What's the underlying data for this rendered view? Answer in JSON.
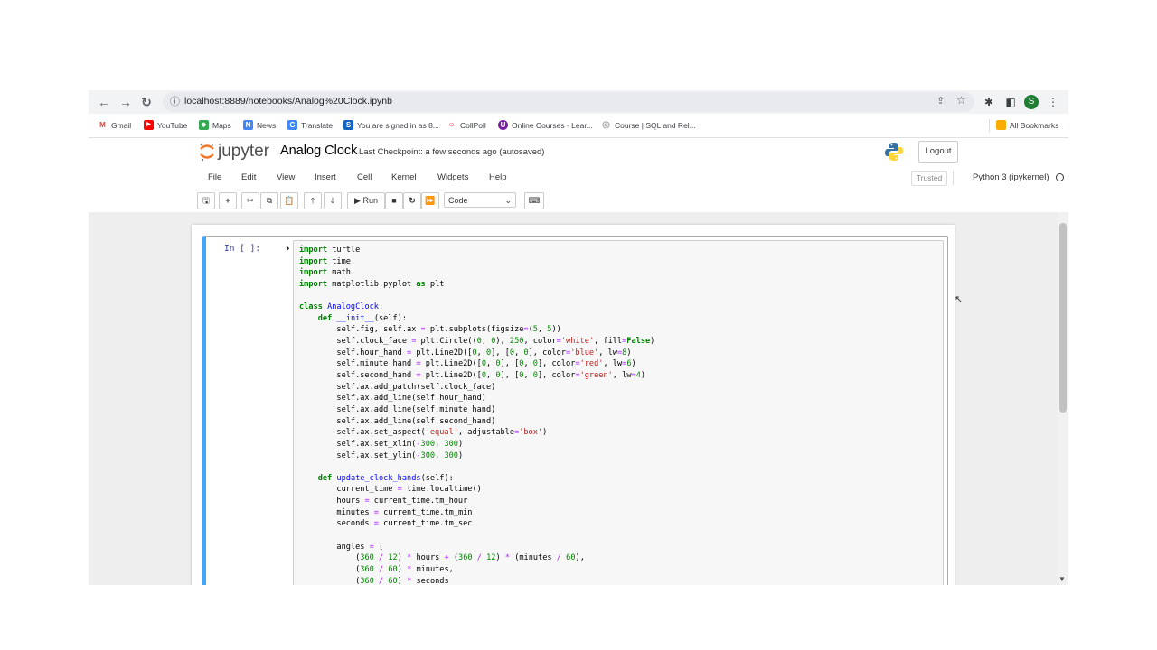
{
  "browser": {
    "url": "localhost:8889/notebooks/Analog%20Clock.ipynb",
    "avatar_letter": "S",
    "bookmarks": [
      {
        "label": "Gmail",
        "icon": "gmail-icon",
        "color": "#ea4335",
        "glyph": "M"
      },
      {
        "label": "YouTube",
        "icon": "youtube-icon",
        "color": "#ff0000",
        "glyph": "▶"
      },
      {
        "label": "Maps",
        "icon": "maps-icon",
        "color": "#34a853",
        "glyph": "◆"
      },
      {
        "label": "News",
        "icon": "news-icon",
        "color": "#4285f4",
        "glyph": "N"
      },
      {
        "label": "Translate",
        "icon": "translate-icon",
        "color": "#4285f4",
        "glyph": "G"
      },
      {
        "label": "You are signed in as 8...",
        "icon": "s-icon",
        "color": "#1565c0",
        "glyph": "S"
      },
      {
        "label": "CollPoll",
        "icon": "collpoll-icon",
        "color": "#e53935",
        "glyph": "○"
      },
      {
        "label": "Online Courses - Lear...",
        "icon": "udemy-icon",
        "color": "#7b1fa2",
        "glyph": "U"
      },
      {
        "label": "Course | SQL and Rel...",
        "icon": "globe-icon",
        "color": "#9e9e9e",
        "glyph": "◎"
      }
    ],
    "all_bookmarks": "All Bookmarks"
  },
  "jupyter": {
    "logo_text": "jupyter",
    "notebook_title": "Analog Clock",
    "checkpoint": "Last Checkpoint: a few seconds ago  (autosaved)",
    "logout": "Logout",
    "menu": [
      "File",
      "Edit",
      "View",
      "Insert",
      "Cell",
      "Kernel",
      "Widgets",
      "Help"
    ],
    "trusted": "Trusted",
    "kernel_name": "Python 3 (ipykernel)",
    "toolbar": {
      "run_label": "Run",
      "cell_type": "Code"
    }
  },
  "cell": {
    "prompt": "In [ ]:",
    "code": [
      "import turtle",
      "import time",
      "import math",
      "import matplotlib.pyplot as plt",
      "",
      "class AnalogClock:",
      "    def __init__(self):",
      "        self.fig, self.ax = plt.subplots(figsize=(5, 5))",
      "        self.clock_face = plt.Circle((0, 0), 250, color='white', fill=False)",
      "        self.hour_hand = plt.Line2D([0, 0], [0, 0], color='blue', lw=8)",
      "        self.minute_hand = plt.Line2D([0, 0], [0, 0], color='red', lw=6)",
      "        self.second_hand = plt.Line2D([0, 0], [0, 0], color='green', lw=4)",
      "        self.ax.add_patch(self.clock_face)",
      "        self.ax.add_line(self.hour_hand)",
      "        self.ax.add_line(self.minute_hand)",
      "        self.ax.add_line(self.second_hand)",
      "        self.ax.set_aspect('equal', adjustable='box')",
      "        self.ax.set_xlim(-300, 300)",
      "        self.ax.set_ylim(-300, 300)",
      "",
      "    def update_clock_hands(self):",
      "        current_time = time.localtime()",
      "        hours = current_time.tm_hour",
      "        minutes = current_time.tm_min",
      "        seconds = current_time.tm_sec",
      "",
      "        angles = [",
      "            (360 / 12) * hours + (360 / 12) * (minutes / 60),",
      "            (360 / 60) * minutes,",
      "            (360 / 60) * seconds"
    ]
  }
}
